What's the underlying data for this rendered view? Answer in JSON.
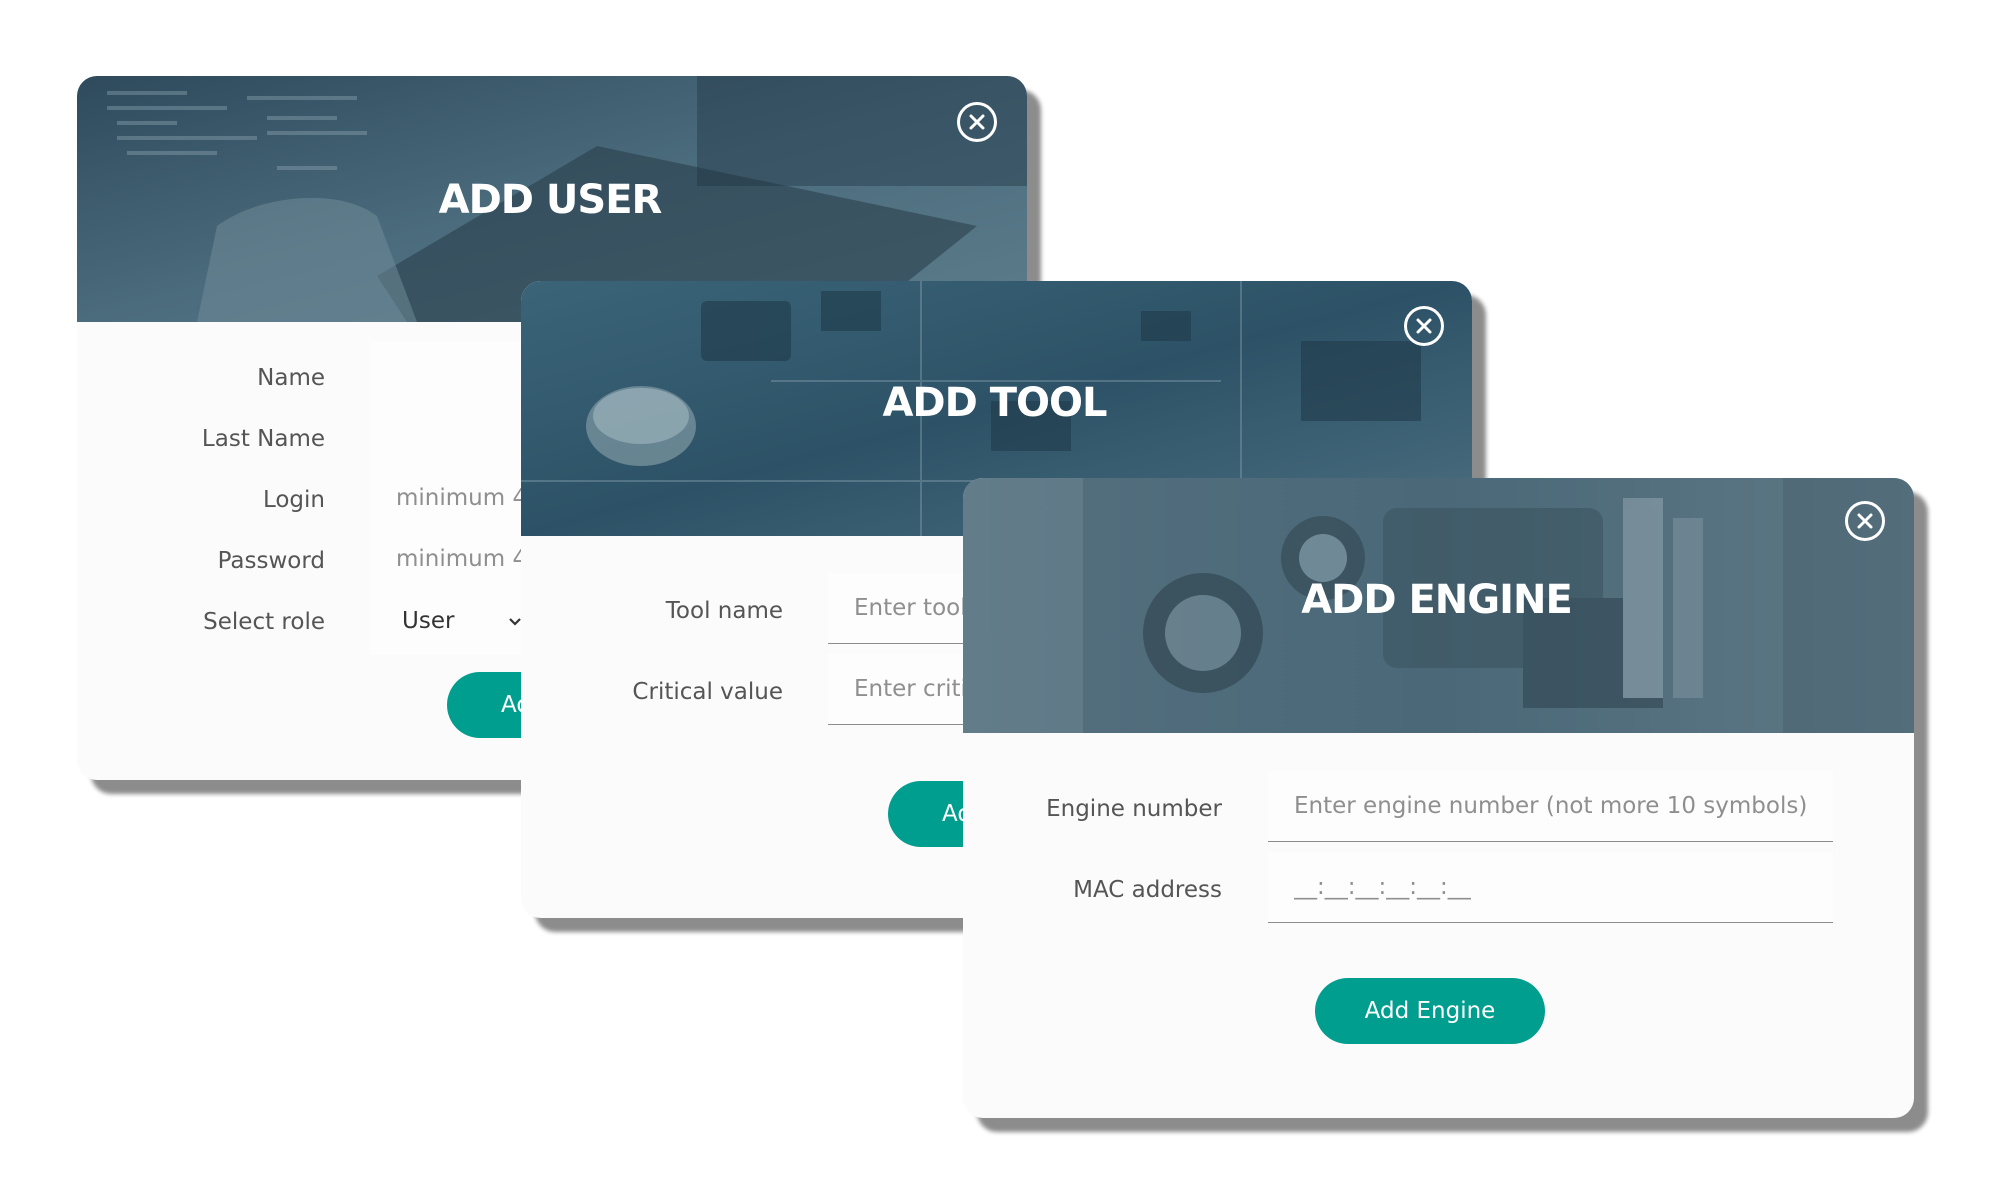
{
  "add_user": {
    "title": "ADD USER",
    "labels": {
      "name": "Name",
      "last_name": "Last Name",
      "login": "Login",
      "password": "Password",
      "role": "Select role"
    },
    "placeholders": {
      "login": "minimum 4",
      "password": "minimum 4"
    },
    "role_value": "User",
    "button_label": "Ad"
  },
  "add_tool": {
    "title": "ADD TOOL",
    "labels": {
      "tool_name": "Tool name",
      "critical_value": "Critical value"
    },
    "placeholders": {
      "tool_name": "Enter tool",
      "critical_value": "Enter critic"
    },
    "button_label": "Ad"
  },
  "add_engine": {
    "title": "ADD ENGINE",
    "labels": {
      "engine_number": "Engine number",
      "mac_address": "MAC address"
    },
    "placeholders": {
      "engine_number": "Enter engine number (not more 10 symbols)",
      "mac_address": "__:__:__:__:__:__"
    },
    "button_label": "Add Engine"
  },
  "colors": {
    "accent": "#009e8e",
    "header_tint": "#3e6273"
  },
  "icons": {
    "close": "close-circle-icon",
    "chevron": "chevron-down-icon"
  }
}
